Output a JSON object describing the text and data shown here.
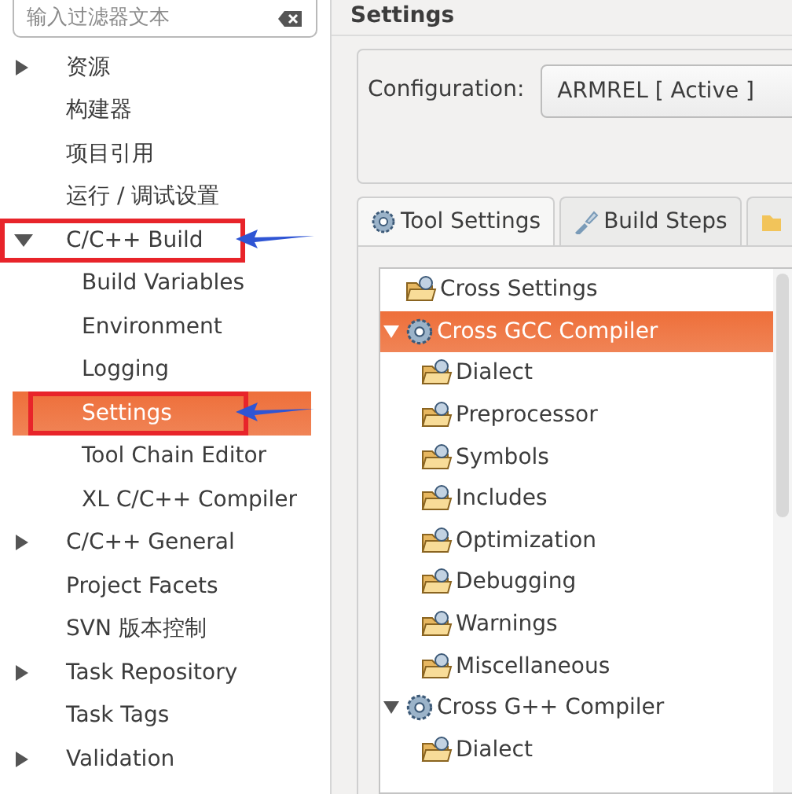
{
  "sidebar": {
    "filter": {
      "placeholder": "输入过滤器文本"
    },
    "items": [
      {
        "label": "资源",
        "expanded": false,
        "selected": false,
        "marked": false
      },
      {
        "label": "构建器",
        "selected": false,
        "marked": false
      },
      {
        "label": "项目引用",
        "selected": false,
        "marked": false
      },
      {
        "label": "运行 / 调试设置",
        "selected": false,
        "marked": false
      },
      {
        "label": "C/C++ Build",
        "expanded": true,
        "selected": false,
        "marked": true,
        "children": [
          {
            "label": "Build Variables",
            "selected": false,
            "marked": false
          },
          {
            "label": "Environment",
            "selected": false,
            "marked": false
          },
          {
            "label": "Logging",
            "selected": false,
            "marked": false
          },
          {
            "label": "Settings",
            "selected": true,
            "marked": true
          },
          {
            "label": "Tool Chain Editor",
            "selected": false,
            "marked": false
          },
          {
            "label": "XL C/C++ Compiler",
            "selected": false,
            "marked": false
          }
        ]
      },
      {
        "label": "C/C++ General",
        "expanded": false,
        "selected": false,
        "marked": false
      },
      {
        "label": "Project Facets",
        "selected": false,
        "marked": false
      },
      {
        "label": "SVN 版本控制",
        "selected": false,
        "marked": false
      },
      {
        "label": "Task Repository",
        "expanded": false,
        "selected": false,
        "marked": false
      },
      {
        "label": "Task Tags",
        "selected": false,
        "marked": false
      },
      {
        "label": "Validation",
        "expanded": false,
        "selected": false,
        "marked": false
      }
    ]
  },
  "page": {
    "title": "Settings",
    "configuration": {
      "label": "Configuration:",
      "value": "ARMREL  [ Active ]"
    },
    "tabs": [
      {
        "label": "Tool Settings",
        "kind": "gear",
        "selected": true
      },
      {
        "label": "Build Steps",
        "kind": "brush",
        "selected": false
      },
      {
        "kind": "folder",
        "selected": false
      }
    ],
    "tree": [
      {
        "label": "Cross Settings",
        "kind": "folder",
        "selected": false
      },
      {
        "label": "Cross GCC Compiler",
        "kind": "gear",
        "expanded": true,
        "selected": true,
        "children": [
          {
            "label": "Dialect",
            "kind": "folder",
            "selected": false
          },
          {
            "label": "Preprocessor",
            "kind": "folder",
            "selected": false
          },
          {
            "label": "Symbols",
            "kind": "folder",
            "selected": false
          },
          {
            "label": "Includes",
            "kind": "folder",
            "selected": false
          },
          {
            "label": "Optimization",
            "kind": "folder",
            "selected": false
          },
          {
            "label": "Debugging",
            "kind": "folder",
            "selected": false
          },
          {
            "label": "Warnings",
            "kind": "folder",
            "selected": false
          },
          {
            "label": "Miscellaneous",
            "kind": "folder",
            "selected": false
          }
        ]
      },
      {
        "label": "Cross G++ Compiler",
        "kind": "gear",
        "expanded": true,
        "selected": false,
        "children": [
          {
            "label": "Dialect",
            "kind": "folder",
            "selected": false
          }
        ]
      }
    ]
  }
}
